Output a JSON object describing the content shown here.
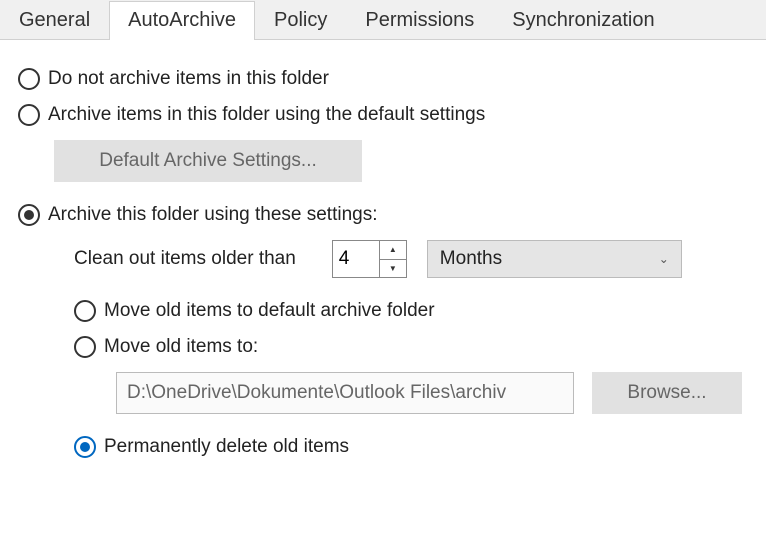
{
  "tabs": {
    "general": "General",
    "autoarchive": "AutoArchive",
    "policy": "Policy",
    "permissions": "Permissions",
    "synchronization": "Synchronization"
  },
  "options": {
    "do_not_archive": "Do not archive items in this folder",
    "archive_default": "Archive items in this folder using the default settings",
    "default_settings_btn": "Default Archive Settings...",
    "archive_custom": "Archive this folder using these settings:",
    "clean_out_label": "Clean out items older than",
    "clean_out_value": "4",
    "clean_out_unit": "Months",
    "move_default": "Move old items to default archive folder",
    "move_custom": "Move old items to:",
    "path": "D:\\OneDrive\\Dokumente\\Outlook Files\\archiv",
    "browse_btn": "Browse...",
    "perm_delete": "Permanently delete old items"
  }
}
